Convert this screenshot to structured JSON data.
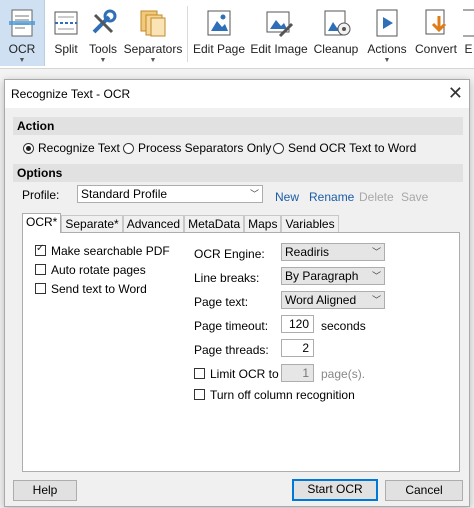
{
  "ribbon": {
    "items": [
      {
        "label": "OCR",
        "icon": "ocr-scan-icon",
        "dropdown": true,
        "active": true
      },
      {
        "label": "Split",
        "icon": "split-document-icon"
      },
      {
        "label": "Tools",
        "icon": "tools-icon",
        "dropdown": true
      },
      {
        "label": "Separators",
        "icon": "separators-icon",
        "dropdown": true
      },
      {
        "label": "Edit Page",
        "icon": "edit-page-icon"
      },
      {
        "label": "Edit Image",
        "icon": "edit-image-icon"
      },
      {
        "label": "Cleanup",
        "icon": "cleanup-icon"
      },
      {
        "label": "Actions",
        "icon": "actions-play-icon",
        "dropdown": true
      },
      {
        "label": "Convert",
        "icon": "convert-icon"
      },
      {
        "label": "E",
        "icon": "export-icon"
      }
    ]
  },
  "dialog": {
    "title": "Recognize Text - OCR",
    "close_glyph": "✕",
    "action_header": "Action",
    "actions": [
      {
        "label": "Recognize Text",
        "selected": true
      },
      {
        "label": "Process Separators Only",
        "selected": false
      },
      {
        "label": "Send OCR Text to Word",
        "selected": false
      }
    ],
    "options_header": "Options",
    "profile_label": "Profile:",
    "profile_value": "Standard Profile",
    "profile_links": {
      "new": "New",
      "rename": "Rename",
      "delete": "Delete",
      "save": "Save"
    },
    "tabs": [
      "OCR*",
      "Separate*",
      "Advanced",
      "MetaData",
      "Maps",
      "Variables"
    ],
    "active_tab": "OCR*",
    "checkboxes": [
      {
        "label": "Make searchable PDF",
        "checked": true
      },
      {
        "label": "Auto rotate pages",
        "checked": false
      },
      {
        "label": "Send text to Word",
        "checked": false
      }
    ],
    "ocr_engine": {
      "label": "OCR Engine:",
      "value": "Readiris"
    },
    "line_breaks": {
      "label": "Line breaks:",
      "value": "By Paragraph"
    },
    "page_text": {
      "label": "Page text:",
      "value": "Word Aligned"
    },
    "page_timeout": {
      "label": "Page timeout:",
      "value": "120",
      "unit": "seconds"
    },
    "page_threads": {
      "label": "Page threads:",
      "value": "2"
    },
    "limit_ocr": {
      "label": "Limit OCR to",
      "value": "1",
      "unit": "page(s).",
      "checked": false
    },
    "column_recognition": {
      "label": "Turn off column recognition",
      "checked": false
    },
    "buttons": {
      "help": "Help",
      "start": "Start OCR",
      "cancel": "Cancel"
    }
  },
  "colors": {
    "accent": "#0078d7",
    "link": "#1a5da6",
    "ribbon_active": "#cfe0f2"
  }
}
